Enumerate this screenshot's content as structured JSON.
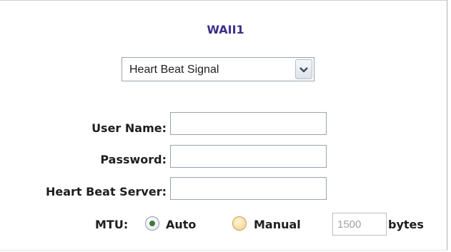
{
  "title": "WAII1",
  "connection": {
    "selected": "Heart Beat Signal",
    "dropdown_icon": "chevron-down-icon"
  },
  "form": {
    "user_name_label": "User Name:",
    "user_name_value": "",
    "password_label": "Password:",
    "password_value": "",
    "heartbeat_server_label": "Heart Beat Server:",
    "heartbeat_server_value": ""
  },
  "mtu": {
    "label": "MTU:",
    "auto_label": "Auto",
    "manual_label": "Manual",
    "selected": "Auto",
    "value": "1500",
    "unit": "bytes"
  },
  "colors": {
    "title": "#3c2f8c",
    "radio_selected": "#3d7a3d",
    "radio_manual": "#f3cf8a"
  }
}
